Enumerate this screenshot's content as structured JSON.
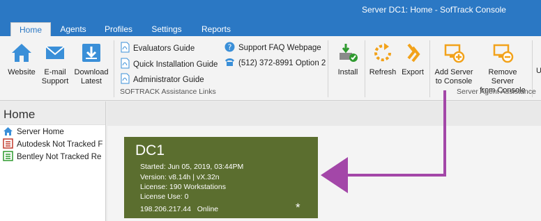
{
  "window": {
    "title": "Server DC1: Home - SofTrack Console"
  },
  "tabs": [
    {
      "label": "Home",
      "active": true
    },
    {
      "label": "Agents"
    },
    {
      "label": "Profiles"
    },
    {
      "label": "Settings"
    },
    {
      "label": "Reports"
    }
  ],
  "ribbon": {
    "website": {
      "label": "Website",
      "icon": "home-icon"
    },
    "email_support": {
      "label_line1": "E-mail",
      "label_line2": "Support",
      "icon": "envelope-icon"
    },
    "download_latest": {
      "label_line1": "Download",
      "label_line2": "Latest",
      "icon": "download-icon"
    },
    "links": {
      "evaluators_guide": "Evaluators Guide",
      "quick_installation_guide": "Quick Installation Guide",
      "administrator_guide": "Administrator Guide",
      "support_faq": "Support FAQ Webpage",
      "phone": "(512) 372-8991 Option 2"
    },
    "assistance_group_label": "SOFTRACK Assistance Links",
    "install": {
      "label": "Install",
      "icon": "install-icon"
    },
    "refresh": {
      "label": "Refresh",
      "icon": "refresh-icon"
    },
    "export": {
      "label": "Export",
      "icon": "export-icon"
    },
    "add_server": {
      "label_line1": "Add Server",
      "label_line2": "to Console",
      "icon": "add-server-icon"
    },
    "remove_server": {
      "label_line1": "Remove Server",
      "label_line2": "from Console",
      "icon": "remove-server-icon"
    },
    "agent_group_label": "Server Agent Assistance",
    "partial_button": "U"
  },
  "left_pane": {
    "header": "Home",
    "items": [
      {
        "label": "Server Home",
        "icon": "home-icon"
      },
      {
        "label": "Autodesk Not Tracked F",
        "icon": "list-icon"
      },
      {
        "label": "Bentley Not Tracked Re",
        "icon": "list-icon"
      }
    ]
  },
  "server_tile": {
    "name": "DC1",
    "started": "Started: Jun 05, 2019, 03:44PM",
    "version": "Version: v8.14h | vX.32n",
    "license": "License: 190 Workstations",
    "license_use": "License Use: 0",
    "ip": "198.206.217.44",
    "status": "Online",
    "star": "*"
  },
  "colors": {
    "accent_blue": "#2b78c4",
    "tile_green": "#5b6e2f",
    "annotation_purple": "#a347a8"
  }
}
